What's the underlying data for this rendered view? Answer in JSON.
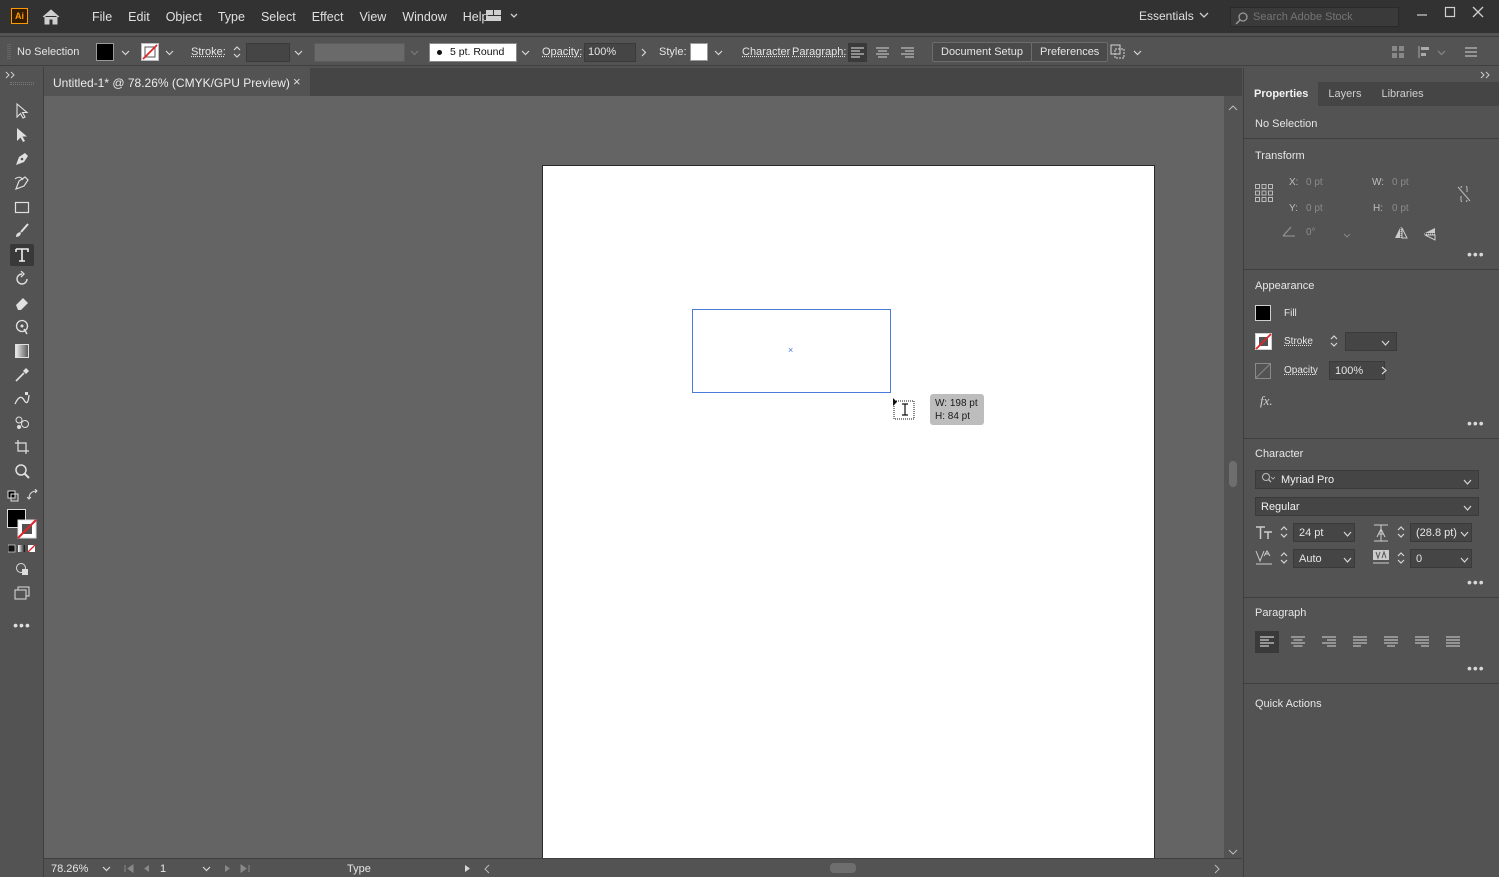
{
  "app": {
    "logo": "Ai"
  },
  "menu": [
    "File",
    "Edit",
    "Object",
    "Type",
    "Select",
    "Effect",
    "View",
    "Window",
    "Help"
  ],
  "workspace": "Essentials",
  "search": {
    "placeholder": "Search Adobe Stock"
  },
  "control": {
    "selection": "No Selection",
    "stroke_label": "Stroke:",
    "brush": "5 pt. Round",
    "opacity_label": "Opacity:",
    "opacity_value": "100%",
    "style_label": "Style:",
    "character": "Character",
    "paragraph": "Paragraph:",
    "document_setup": "Document Setup",
    "preferences": "Preferences"
  },
  "document": {
    "tab_title": "Untitled-1* @ 78.26% (CMYK/GPU Preview)",
    "close": "×"
  },
  "tooltip": {
    "w": "W: 198 pt",
    "h": "H: 84 pt"
  },
  "status": {
    "zoom": "78.26%",
    "artboard": "1",
    "tool": "Type"
  },
  "panel": {
    "tabs": [
      "Properties",
      "Layers",
      "Libraries"
    ],
    "selection": "No Selection",
    "transform": {
      "title": "Transform",
      "x_label": "X:",
      "x_value": "0 pt",
      "y_label": "Y:",
      "y_value": "0 pt",
      "w_label": "W:",
      "w_value": "0 pt",
      "h_label": "H:",
      "h_value": "0 pt",
      "angle_value": "0°"
    },
    "appearance": {
      "title": "Appearance",
      "fill": "Fill",
      "stroke": "Stroke",
      "opacity": "Opacity",
      "opacity_value": "100%",
      "fx": "fx."
    },
    "character": {
      "title": "Character",
      "font": "Myriad Pro",
      "style": "Regular",
      "size": "24 pt",
      "leading": "(28.8 pt)",
      "kerning": "Auto",
      "tracking": "0"
    },
    "paragraph": {
      "title": "Paragraph"
    },
    "quick_actions": {
      "title": "Quick Actions"
    }
  },
  "colors": {
    "accent_orange": "#ff9a00",
    "selection_blue": "#4a7bd9"
  }
}
